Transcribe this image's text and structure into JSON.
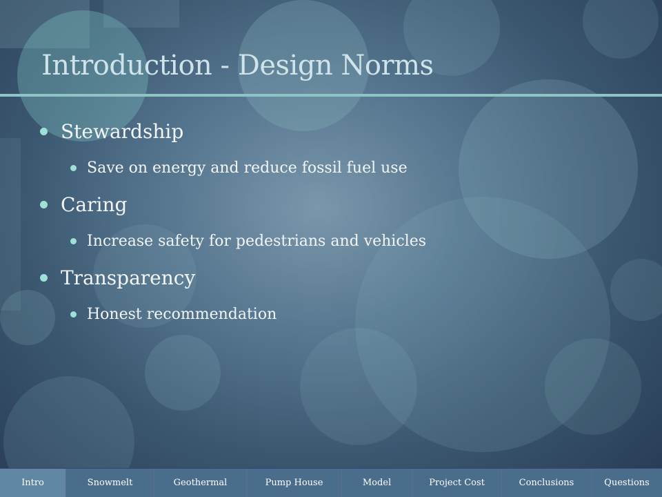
{
  "slide": {
    "title": "Introduction - Design Norms",
    "bullets": [
      {
        "level": 1,
        "text": "Stewardship"
      },
      {
        "level": 2,
        "text": "Save on energy and reduce fossil fuel use"
      },
      {
        "level": 1,
        "text": "Caring"
      },
      {
        "level": 2,
        "text": "Increase safety for pedestrians and vehicles"
      },
      {
        "level": 1,
        "text": "Transparency"
      },
      {
        "level": 2,
        "text": "Honest recommendation"
      }
    ]
  },
  "nav": {
    "tabs": [
      {
        "label": "Intro",
        "active": true
      },
      {
        "label": "Snowmelt",
        "active": false
      },
      {
        "label": "Geothermal",
        "active": false
      },
      {
        "label": "Pump House",
        "active": false
      },
      {
        "label": "Model",
        "active": false
      },
      {
        "label": "Project Cost",
        "active": false
      },
      {
        "label": "Conclusions",
        "active": false
      },
      {
        "label": "Questions",
        "active": false
      }
    ]
  },
  "colors": {
    "title": "#cfe3ea",
    "bullet_dot": "#9fe0d7",
    "title_rule": "#8fc4c6",
    "nav_background": "#4a6d8c",
    "nav_active": "#5f86a3"
  }
}
